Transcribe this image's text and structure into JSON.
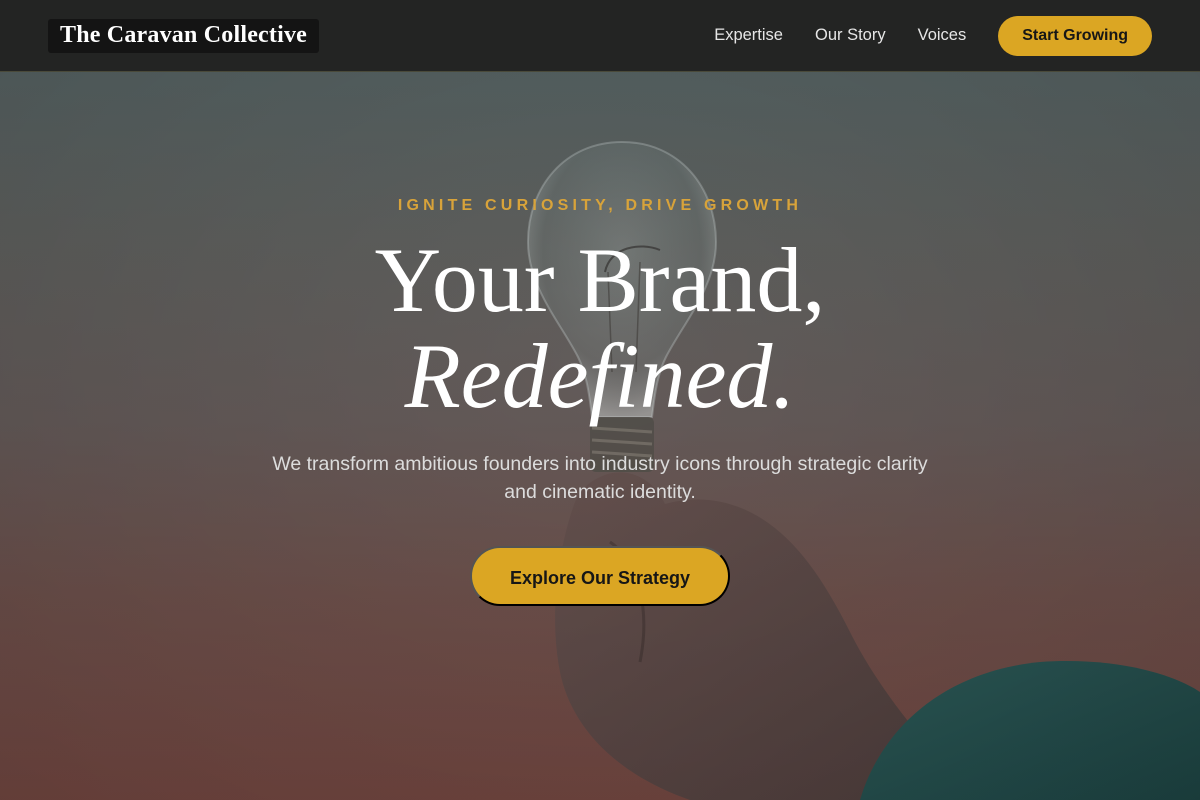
{
  "nav": {
    "brand": "The Caravan Collective",
    "links": [
      {
        "label": "Expertise"
      },
      {
        "label": "Our Story"
      },
      {
        "label": "Voices"
      }
    ],
    "cta_label": "Start Growing"
  },
  "hero": {
    "eyebrow": "IGNITE CURIOSITY, DRIVE GROWTH",
    "headline_line1": "Your Brand,",
    "headline_line2": "Redefined",
    "headline_period": ".",
    "subtitle": "We transform ambitious founders into industry icons through strategic clarity and cinematic identity.",
    "cta_label": "Explore Our Strategy",
    "background_image": "hand-holding-lightbulb"
  },
  "colors": {
    "accent": "#dba623",
    "nav_bg": "#232423",
    "eyebrow": "#d8a33a"
  }
}
